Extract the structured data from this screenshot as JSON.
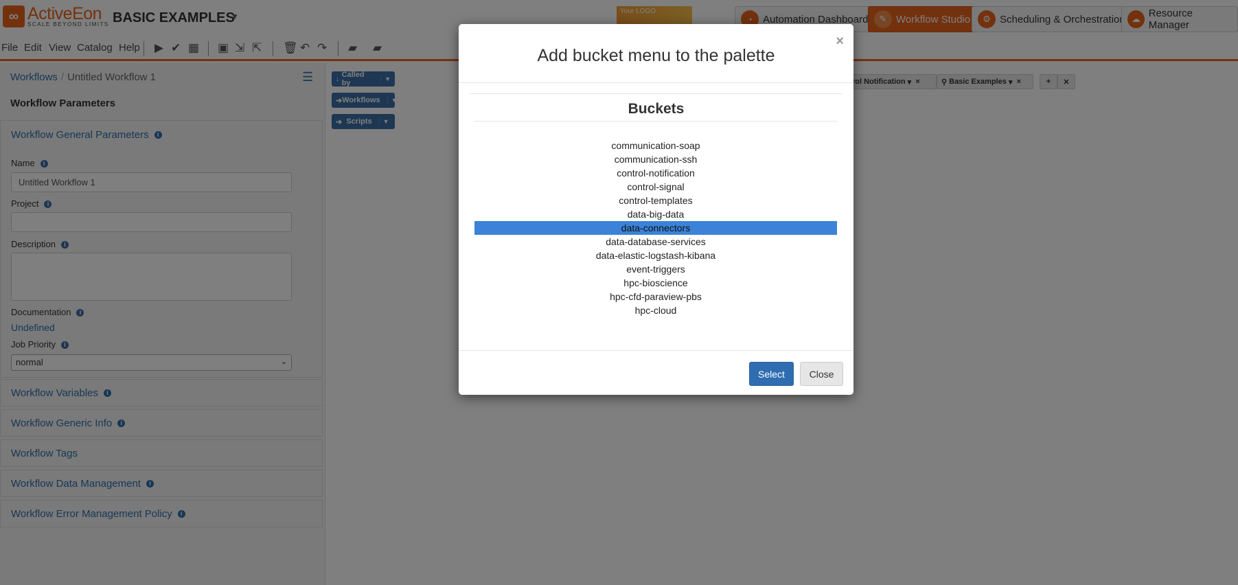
{
  "header": {
    "logo_name": "ActiveEon",
    "logo_tagline": "SCALE BEYOND LIMITS",
    "bucket_title": "BASIC EXAMPLES",
    "your_logo": "Your LOGO",
    "portals": [
      {
        "label": "Automation Dashboard"
      },
      {
        "label": "Workflow Studio"
      },
      {
        "label": "Scheduling & Orchestration"
      },
      {
        "label": "Resource Manager"
      }
    ]
  },
  "menubar": {
    "file": "File",
    "edit": "Edit",
    "view": "View",
    "catalog": "Catalog",
    "help": "Help"
  },
  "breadcrumb": {
    "root": "Workflows",
    "current": "Untitled Workflow 1"
  },
  "left_panel": {
    "title": "Workflow Parameters",
    "general_heading": "Workflow General Parameters",
    "name_label": "Name",
    "name_value": "Untitled Workflow 1",
    "project_label": "Project",
    "project_value": "",
    "description_label": "Description",
    "documentation_label": "Documentation",
    "documentation_value": "Undefined",
    "priority_label": "Job Priority",
    "priority_value": "normal",
    "sections": [
      "Workflow Variables",
      "Workflow Generic Info",
      "Workflow Tags",
      "Workflow Data Management",
      "Workflow Error Management Policy"
    ]
  },
  "palette": {
    "called_by": "Called by",
    "workflows": "Workflows",
    "scripts": "Scripts",
    "tag1": "rol Notification",
    "tag2": "Basic Examples"
  },
  "modal": {
    "title": "Add bucket menu to the palette",
    "buckets_heading": "Buckets",
    "buckets": [
      "communication-soap",
      "communication-ssh",
      "control-notification",
      "control-signal",
      "control-templates",
      "data-big-data",
      "data-connectors",
      "data-database-services",
      "data-elastic-logstash-kibana",
      "event-triggers",
      "hpc-bioscience",
      "hpc-cfd-paraview-pbs",
      "hpc-cloud"
    ],
    "selected_bucket": "data-connectors",
    "select_label": "Select",
    "close_label": "Close"
  },
  "colors": {
    "brand_orange": "#e8621b",
    "link_blue": "#2f6fad",
    "selection_blue": "#3b82d8",
    "primary_button": "#2f6db0"
  }
}
